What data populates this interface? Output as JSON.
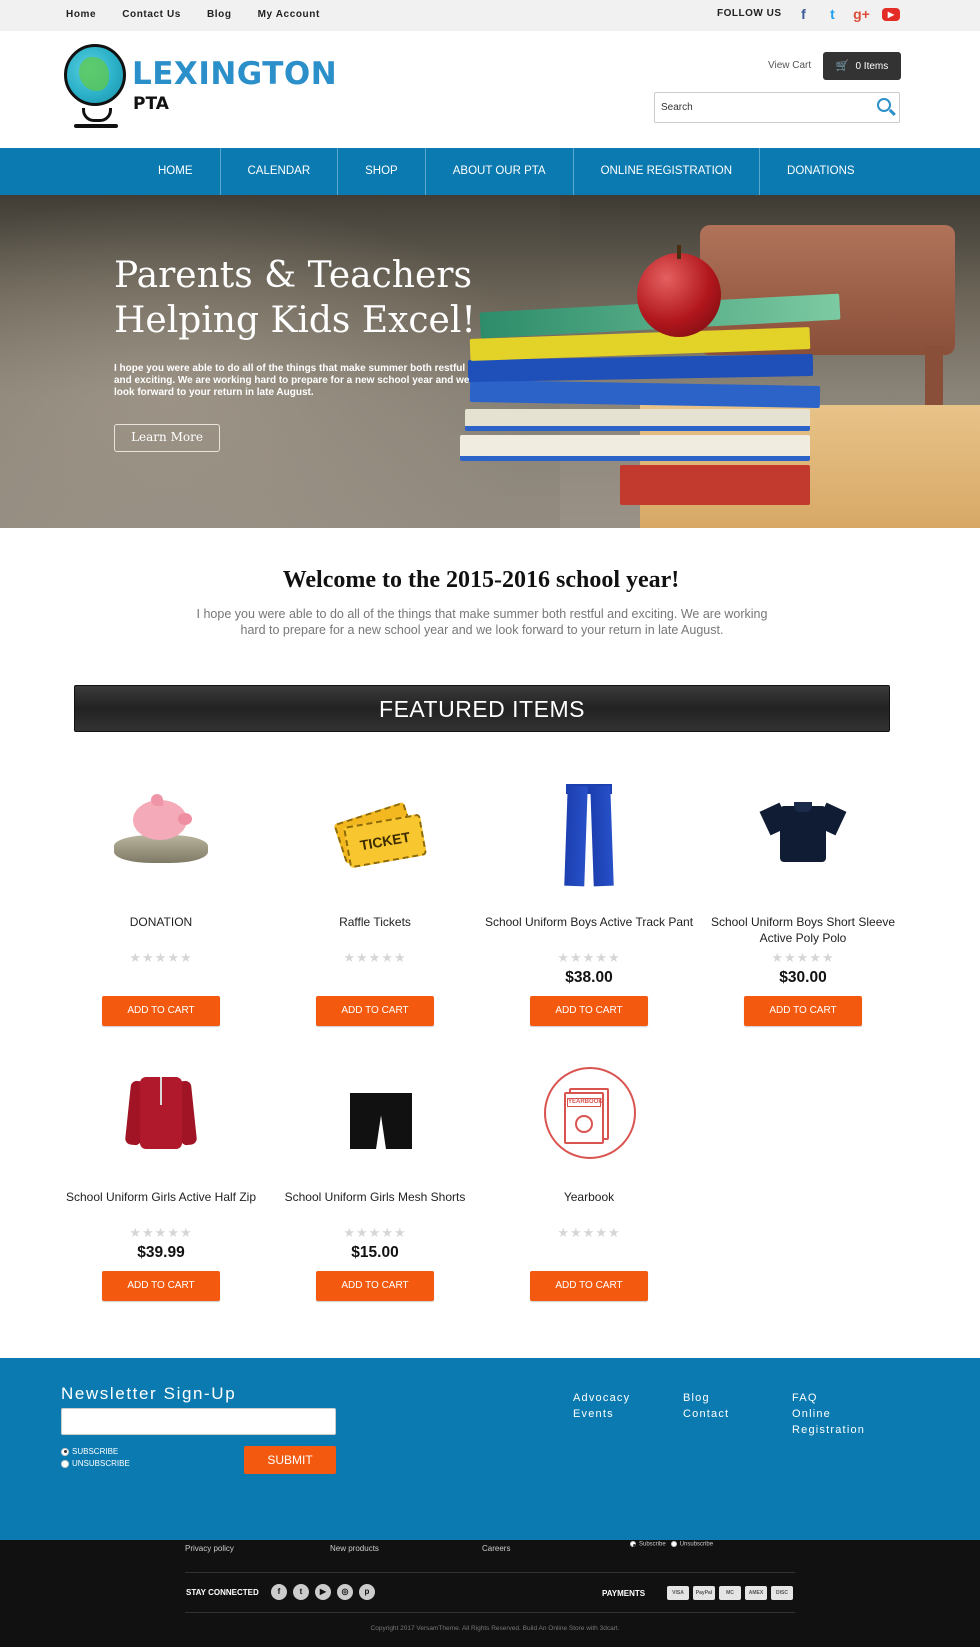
{
  "topbar": {
    "links": [
      "Home",
      "Contact Us",
      "Blog",
      "My Account"
    ],
    "follow_label": "FOLLOW US",
    "social": [
      "facebook-icon",
      "twitter-icon",
      "google-plus-icon",
      "youtube-icon"
    ]
  },
  "header": {
    "logo_title": "LEXINGTON",
    "logo_subtitle": "PTA",
    "view_cart": "View Cart",
    "cart_count": "0 Items",
    "search_placeholder": "Search"
  },
  "nav": {
    "items": [
      "HOME",
      "CALENDAR",
      "SHOP",
      "ABOUT OUR PTA",
      "ONLINE REGISTRATION",
      "DONATIONS"
    ]
  },
  "hero": {
    "title_line1": "Parents & Teachers",
    "title_line2": "Helping Kids Excel!",
    "text": "I hope you were able to do all of the things that make summer both restful and exciting.  We are working hard to prepare for a new school year and we look forward to your return in late August.",
    "button": "Learn More"
  },
  "welcome": {
    "title": "Welcome to the 2015-2016 school year!",
    "text": "I hope you were able to do all of the things that make summer both restful and exciting. We are working hard to prepare for a new school year and we look forward to your return in late August."
  },
  "featured": {
    "title": "FEATURED ITEMS",
    "add_to_cart": "ADD TO CART",
    "stars": "★★★★★",
    "products": [
      {
        "name": "DONATION",
        "price": "",
        "icon": "piggy-bank-icon"
      },
      {
        "name": "Raffle Tickets",
        "price": "",
        "icon": "ticket-icon",
        "icon_text": "TICKET"
      },
      {
        "name": "School Uniform Boys Active Track Pant",
        "price": "$38.00",
        "icon": "track-pants-icon"
      },
      {
        "name": "School Uniform Boys Short Sleeve Active Poly Polo",
        "price": "$30.00",
        "icon": "polo-shirt-icon"
      },
      {
        "name": "School Uniform Girls Active Half Zip",
        "price": "$39.99",
        "icon": "half-zip-icon"
      },
      {
        "name": "School Uniform Girls Mesh Shorts",
        "price": "$15.00",
        "icon": "shorts-icon"
      },
      {
        "name": "Yearbook",
        "price": "",
        "icon": "yearbook-icon",
        "icon_text": "YEARBOOK"
      }
    ]
  },
  "newsletter": {
    "title": "Newsletter Sign-Up",
    "subscribe": "SUBSCRIBE",
    "unsubscribe": "UNSUBSCRIBE",
    "submit": "SUBMIT",
    "col1": [
      "Advocacy",
      "Events"
    ],
    "col2": [
      "Blog",
      "Contact"
    ],
    "col3": [
      "FAQ",
      "Online",
      "Registration"
    ]
  },
  "footer": {
    "links": [
      "Privacy policy",
      "New products",
      "Careers"
    ],
    "subscribe": "Subscribe",
    "unsubscribe": "Unsubscribe",
    "stay_connected": "STAY CONNECTED",
    "payments": "PAYMENTS",
    "payment_icons": [
      "VISA",
      "PayPal",
      "MC",
      "AMEX",
      "DISC"
    ],
    "copyright": "Copyright 2017 VersamTheme. All Rights Reserved. Build An Online Store with 3dcart."
  },
  "colors": {
    "brand_blue": "#0a7ab0",
    "accent_orange": "#f35a0f"
  }
}
